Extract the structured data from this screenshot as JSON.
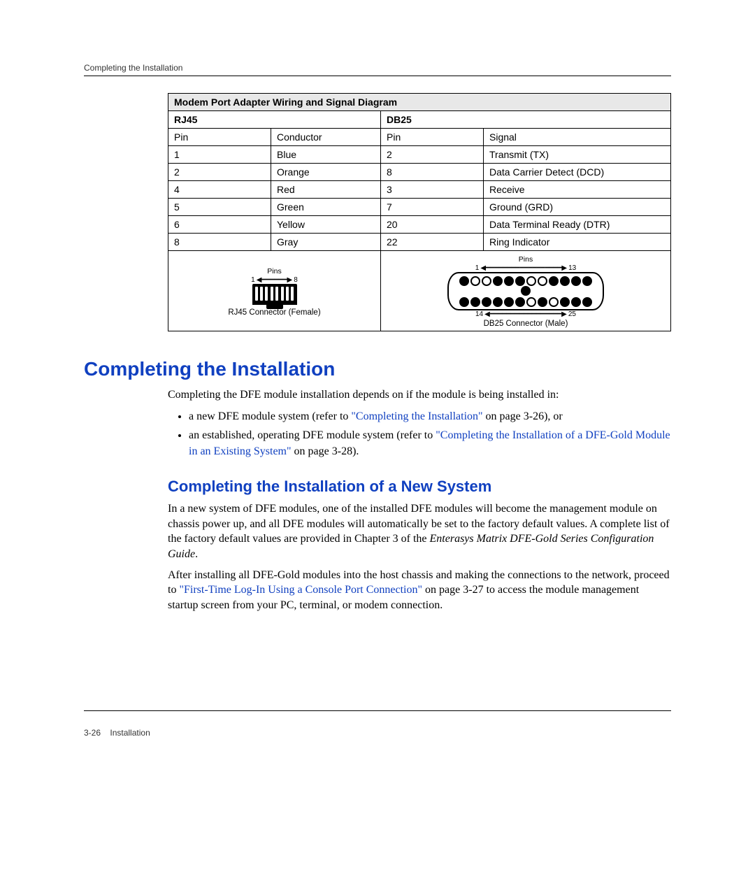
{
  "running_head": "Completing the Installation",
  "table_title": "Modem Port Adapter Wiring and Signal Diagram",
  "rj45_header": "RJ45",
  "db25_header": "DB25",
  "col_pin": "Pin",
  "col_conductor": "Conductor",
  "col_signal": "Signal",
  "rows": [
    {
      "rpin": "1",
      "cond": "Blue",
      "dpin": "2",
      "sig": "Transmit (TX)"
    },
    {
      "rpin": "2",
      "cond": "Orange",
      "dpin": "8",
      "sig": "Data Carrier Detect (DCD)"
    },
    {
      "rpin": "4",
      "cond": "Red",
      "dpin": "3",
      "sig": "Receive"
    },
    {
      "rpin": "5",
      "cond": "Green",
      "dpin": "7",
      "sig": "Ground (GRD)"
    },
    {
      "rpin": "6",
      "cond": "Yellow",
      "dpin": "20",
      "sig": "Data Terminal Ready (DTR)"
    },
    {
      "rpin": "8",
      "cond": "Gray",
      "dpin": "22",
      "sig": "Ring Indicator"
    }
  ],
  "diag_pins_label": "Pins",
  "rj45_left_num": "1",
  "rj45_right_num": "8",
  "rj45_caption": "RJ45 Connector (Female)",
  "db25_top_left": "1",
  "db25_top_right": "13",
  "db25_bot_left": "14",
  "db25_bot_right": "25",
  "db25_caption": "DB25  Connector  (Male)",
  "h1": "Completing the Installation",
  "intro_para": "Completing the DFE module installation depends on if the module is being installed in:",
  "bullets": [
    {
      "pre": "a new DFE module system (refer to ",
      "link": "\"Completing the Installation\"",
      "post": " on page 3-26), or"
    },
    {
      "pre": "an established, operating DFE module system (refer to ",
      "link": "\"Completing the Installation of a DFE-Gold Module in an Existing System\"",
      "post": " on page 3-28)."
    }
  ],
  "h2": "Completing the Installation of a New System",
  "para2a": "In a new system of DFE modules, one of the installed DFE modules will become the management module on chassis power up, and all DFE modules will automatically be set to the factory default values. A complete list of the factory default values are provided in Chapter 3 of the ",
  "para2a_ital": "Enterasys Matrix DFE-Gold Series Configuration Guide",
  "para2a_end": ".",
  "para3_pre": "After installing all DFE-Gold modules into the host chassis and making the connections to the network, proceed to ",
  "para3_link": "\"First-Time Log-In Using a Console Port Connection\"",
  "para3_post": " on page 3-27 to access the module management startup screen from your PC, terminal, or modem connection.",
  "footer_page": "3-26",
  "footer_chapter": "Installation"
}
